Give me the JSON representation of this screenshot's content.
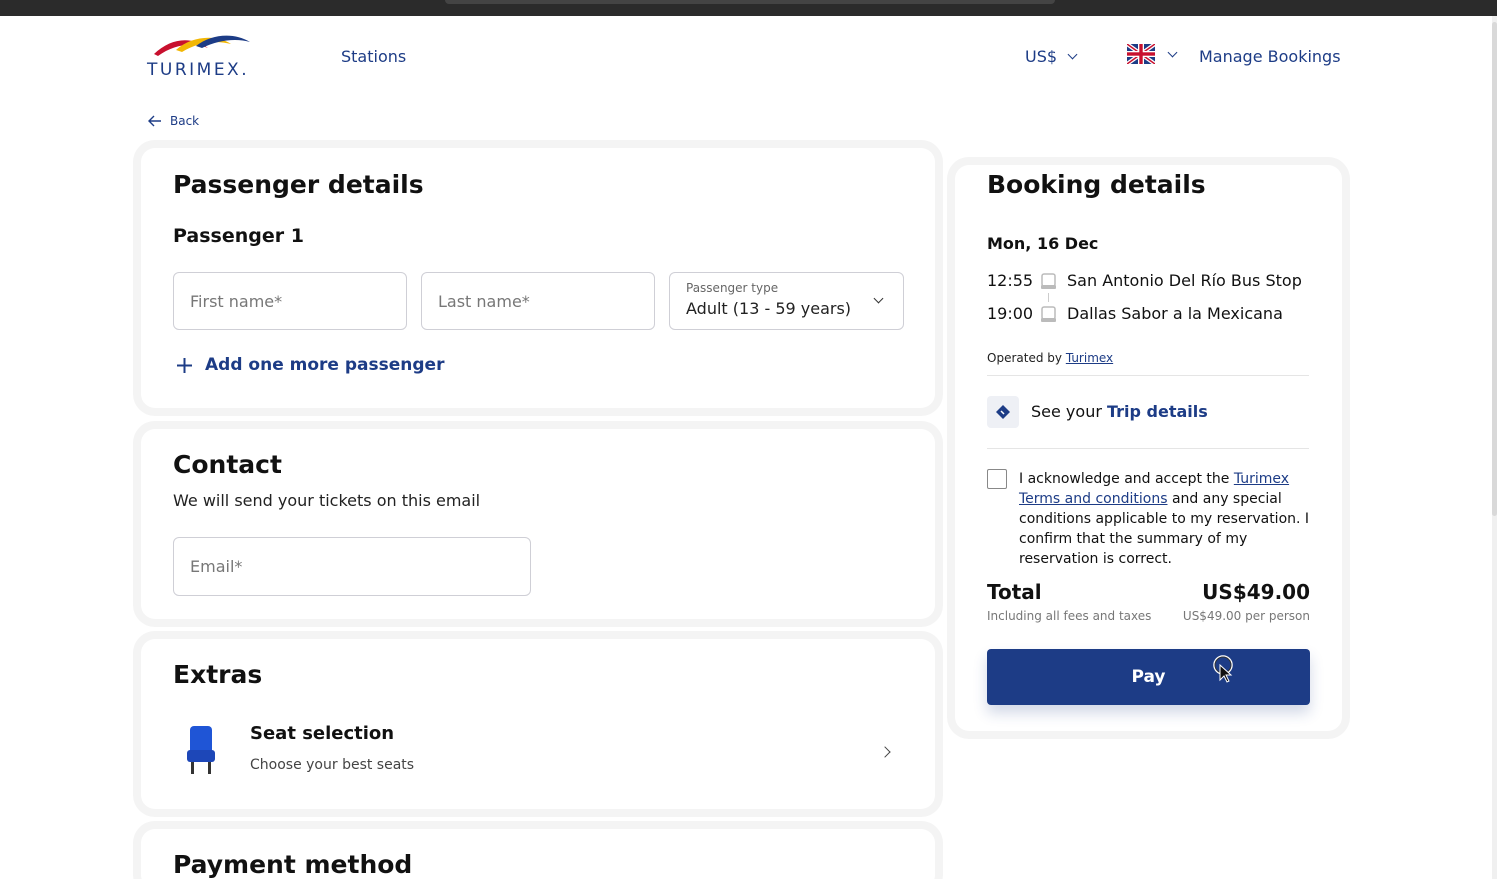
{
  "header": {
    "logo_text": "TURIMEX.",
    "nav_stations": "Stations",
    "currency": "US$",
    "manage_bookings": "Manage Bookings"
  },
  "back_label": "Back",
  "passenger": {
    "title": "Passenger details",
    "subtitle": "Passenger 1",
    "first_name_placeholder": "First name*",
    "last_name_placeholder": "Last name*",
    "type_label": "Passenger type",
    "type_value": "Adult (13 - 59 years)",
    "add_more": "Add one more passenger"
  },
  "contact": {
    "title": "Contact",
    "description": "We will send your tickets on this email",
    "email_placeholder": "Email*"
  },
  "extras": {
    "title": "Extras",
    "seat_title": "Seat selection",
    "seat_subtitle": "Choose your best seats"
  },
  "payment": {
    "title": "Payment method"
  },
  "booking": {
    "title": "Booking details",
    "date": "Mon, 16 Dec",
    "departure_time": "12:55",
    "departure_stop": "San Antonio Del Río Bus Stop",
    "arrival_time": "19:00",
    "arrival_stop": "Dallas Sabor a la Mexicana",
    "operated_by": "Operated by",
    "operator": "Turimex",
    "trip_prefix": "See your",
    "trip_link": "Trip details",
    "terms_1": "I acknowledge and accept the",
    "terms_link_1": "Turimex",
    "terms_link_2": "Terms and conditions",
    "terms_2": "and any special conditions applicable to my reservation. I confirm that the summary of my reservation is correct.",
    "total_label": "Total",
    "total_value": "US$49.00",
    "fees_note": "Including all fees and taxes",
    "per_person": "US$49.00 per person",
    "pay_label": "Pay"
  },
  "colors": {
    "brand": "#1d3c86",
    "card_border": "#f4f4f4"
  }
}
